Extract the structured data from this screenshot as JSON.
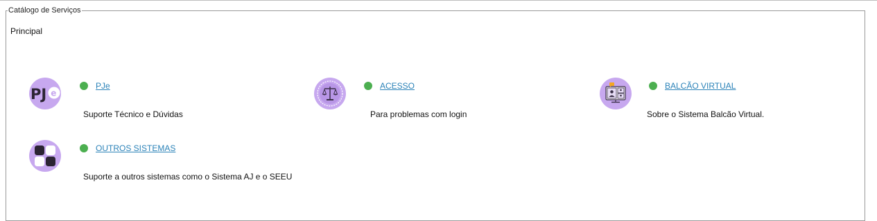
{
  "panel": {
    "legend": "Catálogo de Serviços",
    "section_title": "Principal"
  },
  "services": [
    {
      "name": "PJe",
      "description": "Suporte Técnico e Dúvidas",
      "icon": "pje-logo-icon",
      "status_color": "#4caf50"
    },
    {
      "name": "ACESSO",
      "description": "Para problemas com login",
      "icon": "scales-badge-icon",
      "status_color": "#4caf50"
    },
    {
      "name": "BALCÃO VIRTUAL",
      "description": "Sobre o Sistema Balcão Virtual.",
      "icon": "video-call-monitor-icon",
      "status_color": "#4caf50"
    },
    {
      "name": "OUTROS SISTEMAS",
      "description": "Suporte a outros sistemas como o Sistema AJ e o SEEU",
      "icon": "grid-squares-icon",
      "status_color": "#4caf50"
    }
  ],
  "pje_logo_text": "PJe",
  "colors": {
    "icon_bg": "#c7a8ef",
    "link": "#2a82b8",
    "status_online": "#4caf50"
  }
}
